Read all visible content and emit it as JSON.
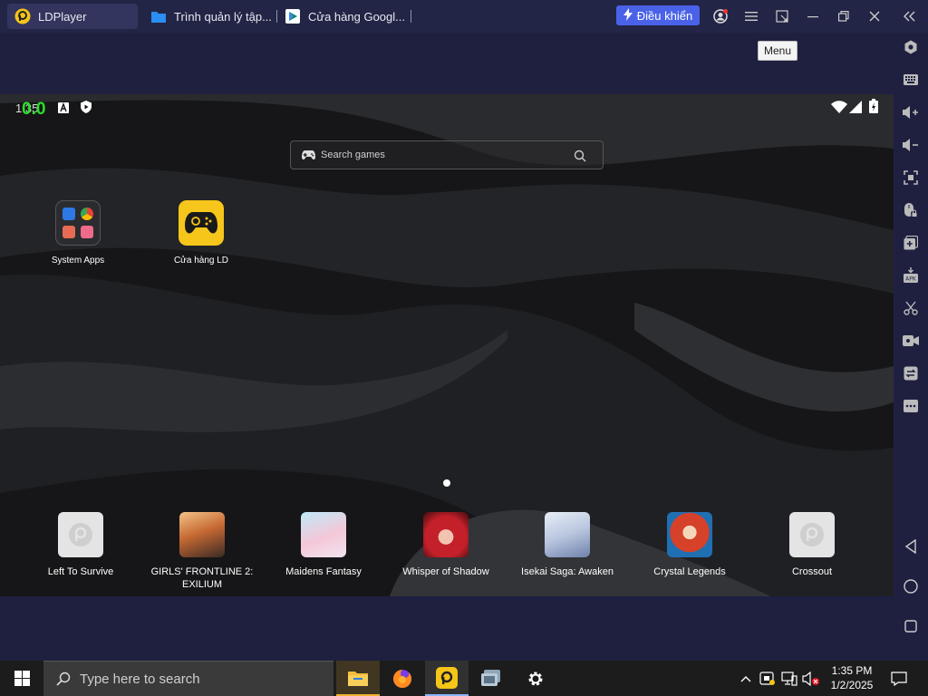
{
  "titlebar": {
    "tabs": [
      {
        "label": "LDPlayer",
        "icon": "ldplayer-logo-icon"
      },
      {
        "label": "Trình quản lý tập...",
        "icon": "folder-icon"
      },
      {
        "label": "Cửa hàng Googl...",
        "icon": "play-store-icon"
      }
    ],
    "control_button": "Điều khiển",
    "tooltip": "Menu",
    "accent": "#4a62e8"
  },
  "android": {
    "status": {
      "time": "1:35",
      "fps": "0.0"
    },
    "search_placeholder": "Search games",
    "home_apps": [
      {
        "label": "System Apps"
      },
      {
        "label": "Cửa hàng LD"
      }
    ],
    "dock_apps": [
      {
        "label": "Left To Survive"
      },
      {
        "label": "GIRLS' FRONTLINE 2: EXILIUM"
      },
      {
        "label": "Maidens Fantasy"
      },
      {
        "label": "Whisper of Shadow"
      },
      {
        "label": "Isekai Saga: Awaken"
      },
      {
        "label": "Crystal Legends"
      },
      {
        "label": "Crossout"
      }
    ]
  },
  "sidebar": {
    "icons": [
      "settings-icon",
      "keyboard-icon",
      "volume-up-icon",
      "volume-down-icon",
      "fullscreen-icon",
      "mouse-lock-icon",
      "add-instance-icon",
      "apk-install-icon",
      "screenshot-icon",
      "record-icon",
      "sync-icon",
      "more-icon",
      "back-icon",
      "home-icon",
      "recents-icon"
    ]
  },
  "taskbar": {
    "search_placeholder": "Type here to search",
    "time": "1:35 PM",
    "date": "1/2/2025"
  }
}
